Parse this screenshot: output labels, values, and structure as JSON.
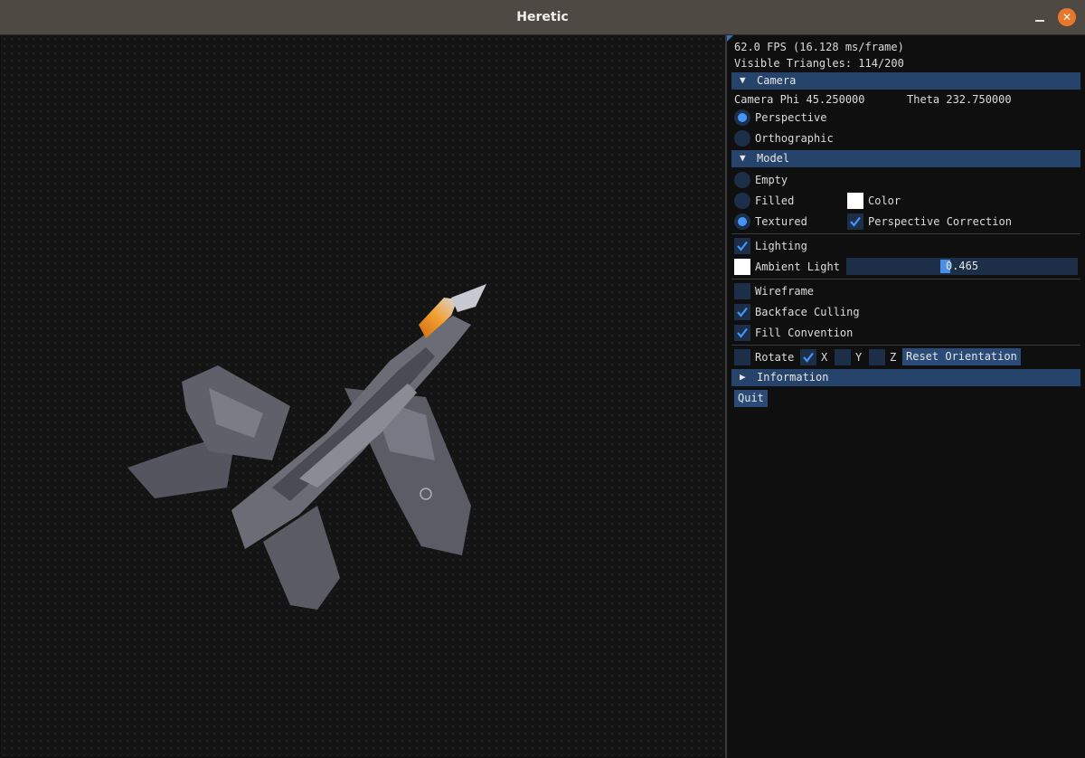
{
  "window": {
    "title": "Heretic"
  },
  "stats": {
    "fps": "62.0 FPS (16.128 ms/frame)",
    "triangles": "Visible Triangles: 114/200"
  },
  "camera": {
    "header": "Camera",
    "phi": "Camera Phi 45.250000",
    "theta": "Theta 232.750000",
    "projection": {
      "perspective": "Perspective",
      "orthographic": "Orthographic",
      "selected": "Perspective"
    }
  },
  "model": {
    "header": "Model",
    "modes": {
      "empty": "Empty",
      "filled": "Filled",
      "textured": "Textured",
      "selected": "Textured"
    },
    "color_label": "Color",
    "color_value": "#ffffff",
    "perspective_correction": {
      "label": "Perspective Correction",
      "checked": true
    },
    "lighting": {
      "label": "Lighting",
      "checked": true
    },
    "ambient_light": {
      "label": "Ambient Light",
      "value": "0.465",
      "fraction": 0.465,
      "color": "#ffffff"
    },
    "wireframe": {
      "label": "Wireframe",
      "checked": false
    },
    "backface_culling": {
      "label": "Backface Culling",
      "checked": true
    },
    "fill_convention": {
      "label": "Fill Convention",
      "checked": true
    },
    "rotate": {
      "label": "Rotate",
      "checked": false,
      "x_label": "X",
      "x": true,
      "y_label": "Y",
      "y": false,
      "z_label": "Z",
      "z": false
    },
    "reset_orientation": "Reset Orientation"
  },
  "information": {
    "header": "Information"
  },
  "quit": "Quit",
  "colors": {
    "accent": "#4296fa",
    "header_bg": "#26436b",
    "frame_bg": "#1d2f48",
    "button_bg": "#2a4b78",
    "close_button": "#e9772b"
  }
}
